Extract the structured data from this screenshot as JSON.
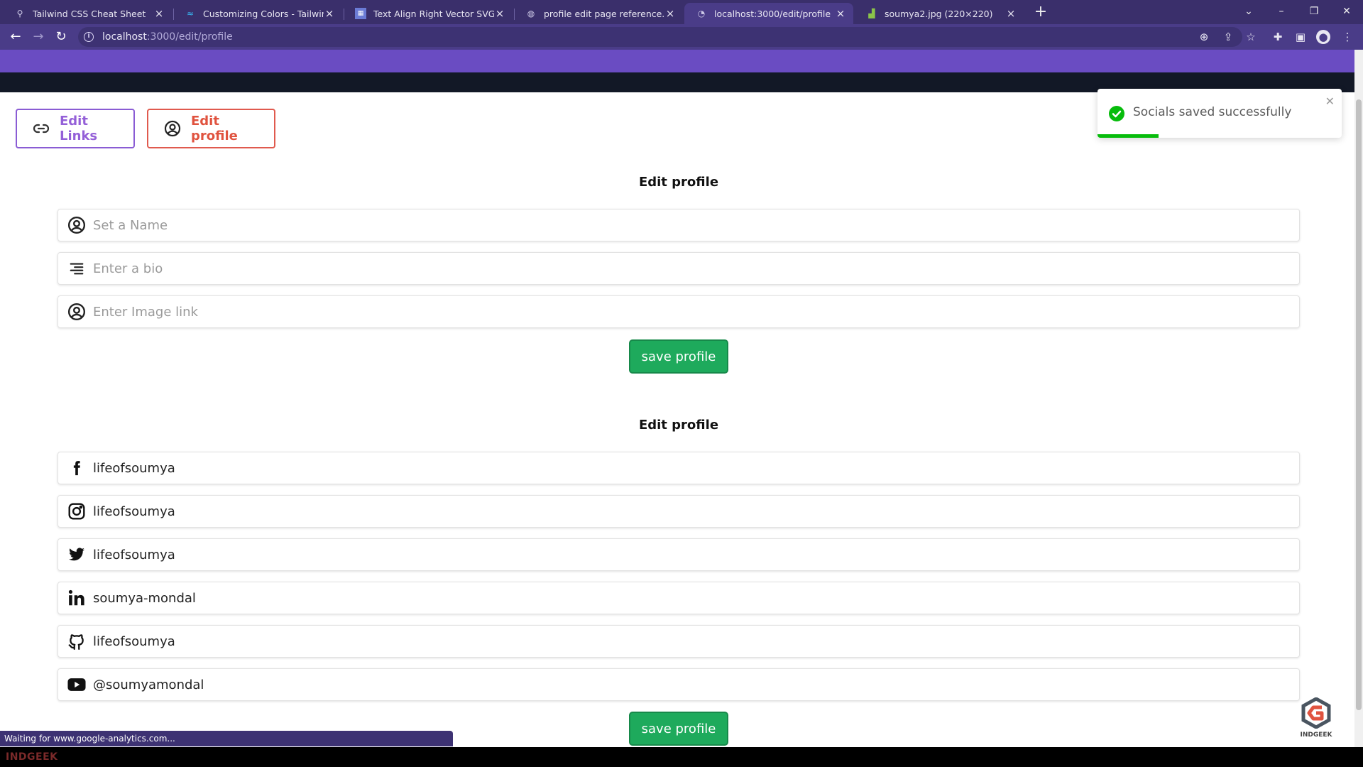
{
  "browser": {
    "tabs": [
      {
        "title": "Tailwind CSS Cheat Sheet",
        "active": false
      },
      {
        "title": "Customizing Colors - Tailwind CSS",
        "active": false
      },
      {
        "title": "Text Align Right Vector SVG Icon",
        "active": false
      },
      {
        "title": "profile edit page reference.png (",
        "active": false
      },
      {
        "title": "localhost:3000/edit/profile",
        "active": true
      },
      {
        "title": "soumya2.jpg (220×220)",
        "active": false
      }
    ],
    "url_host": "localhost",
    "url_path": ":3000/edit/profile",
    "status_text": "Waiting for www.google-analytics.com..."
  },
  "nav": {
    "edit_links_label": "Edit Links",
    "edit_profile_label": "Edit profile"
  },
  "profile_section": {
    "title": "Edit profile",
    "fields": [
      {
        "icon": "user-circle-icon",
        "placeholder": "Set a Name",
        "value": ""
      },
      {
        "icon": "text-align-right-icon",
        "placeholder": "Enter a bio",
        "value": ""
      },
      {
        "icon": "user-circle-icon",
        "placeholder": "Enter Image link",
        "value": ""
      }
    ],
    "save_label": "save profile"
  },
  "socials_section": {
    "title": "Edit profile",
    "fields": [
      {
        "icon": "facebook-icon",
        "value": "lifeofsoumya"
      },
      {
        "icon": "instagram-icon",
        "value": "lifeofsoumya"
      },
      {
        "icon": "twitter-icon",
        "value": "lifeofsoumya"
      },
      {
        "icon": "linkedin-icon",
        "value": "soumya-mondal"
      },
      {
        "icon": "github-icon",
        "value": "lifeofsoumya"
      },
      {
        "icon": "youtube-icon",
        "value": "@soumyamondal"
      }
    ],
    "save_label": "save profile"
  },
  "toast": {
    "message": "Socials saved successfully",
    "progress_fraction": 0.25
  },
  "watermark": {
    "logo_text": "INDGEEK",
    "bottom_text": "INDGEEK"
  },
  "colors": {
    "browser_frame": "#3a2f6b",
    "header_strip": "#6a4cc2",
    "edit_links": "#9460d8",
    "edit_profile": "#e0533f",
    "save_button": "#1eaa5c",
    "toast_success": "#07bc0c"
  }
}
